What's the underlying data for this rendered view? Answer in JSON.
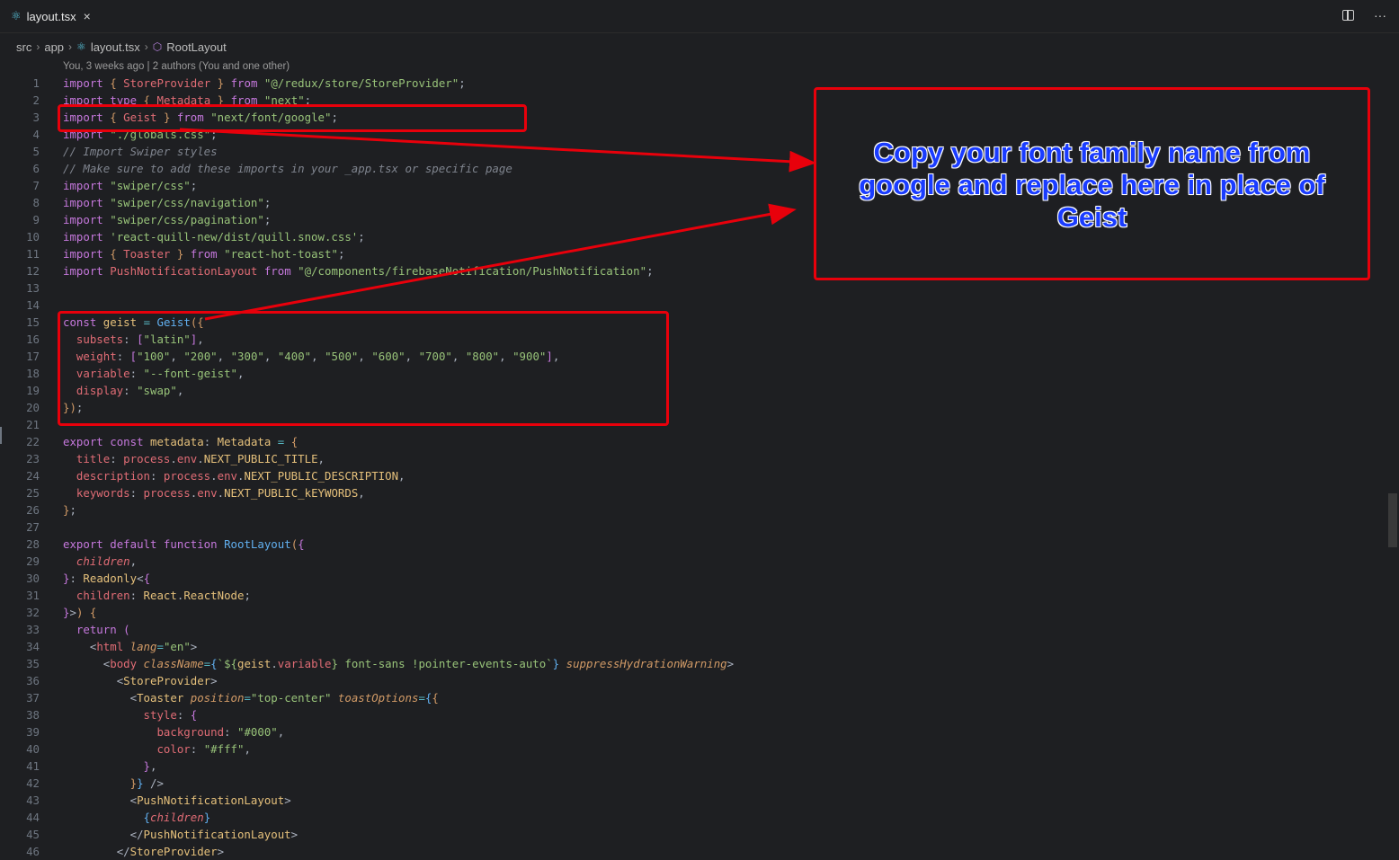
{
  "tab": {
    "title": "layout.tsx",
    "close": "×"
  },
  "breadcrumb": {
    "src": "src",
    "app": "app",
    "file": "layout.tsx",
    "symbol": "RootLayout"
  },
  "blame": "You, 3 weeks ago | 2 authors (You and one other)",
  "line_numbers": [
    "1",
    "2",
    "3",
    "4",
    "5",
    "6",
    "7",
    "8",
    "9",
    "10",
    "11",
    "12",
    "13",
    "14",
    "15",
    "16",
    "17",
    "18",
    "19",
    "20",
    "21",
    "22",
    "23",
    "24",
    "25",
    "26",
    "27",
    "28",
    "29",
    "30",
    "31",
    "32",
    "33",
    "34",
    "35",
    "36",
    "37",
    "38",
    "39",
    "40",
    "41",
    "42",
    "43",
    "44",
    "45",
    "46"
  ],
  "annotation": {
    "text": "Copy your font family name from google and replace here in place of Geist"
  },
  "colors": {
    "annotation_border": "#e8000b",
    "annotation_text": "#1a3cff",
    "background": "#1e1f22"
  },
  "icons": {
    "tab": "react-icon",
    "split": "split-editor-icon",
    "more": "more-actions-icon",
    "symbol": "symbol-method-icon"
  }
}
